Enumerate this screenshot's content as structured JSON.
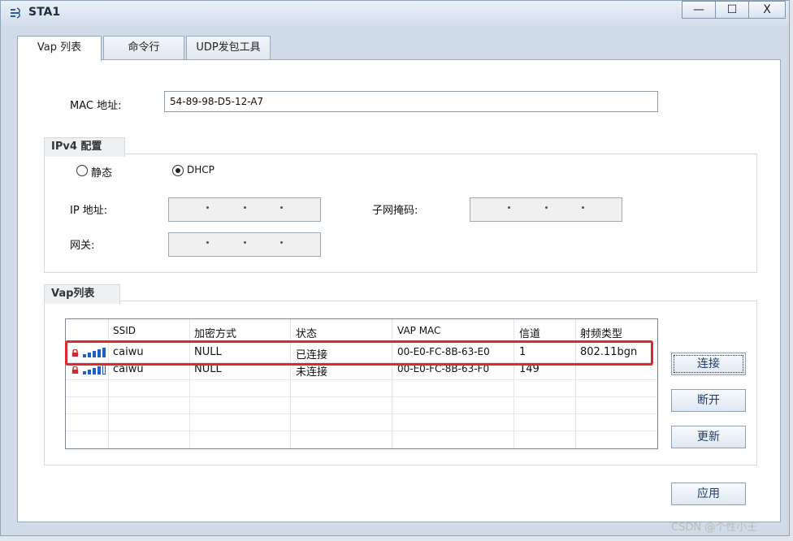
{
  "window": {
    "title": "STA1",
    "min_symbol": "—",
    "max_symbol": "☐",
    "close_symbol": "X"
  },
  "tabs": [
    {
      "label": "Vap 列表"
    },
    {
      "label": "命令行"
    },
    {
      "label": "UDP发包工具"
    }
  ],
  "mac": {
    "label": "MAC 地址:",
    "value": "54-89-98-D5-12-A7"
  },
  "ipv4": {
    "group_label": "IPv4 配置",
    "static_label": "静态",
    "dhcp_label": "DHCP",
    "selected": "DHCP",
    "ip_label": "IP 地址:",
    "mask_label": "子网掩码:",
    "gateway_label": "网关:"
  },
  "vap": {
    "group_label": "Vap列表",
    "columns": [
      "SSID",
      "加密方式",
      "状态",
      "VAP MAC",
      "信道",
      "射频类型"
    ],
    "rows": [
      {
        "ssid": "caiwu",
        "encryption": "NULL",
        "status": "已连接",
        "vap_mac": "00-E0-FC-8B-63-E0",
        "channel": "1",
        "radio_type": "802.11bgn"
      },
      {
        "ssid": "caiwu",
        "encryption": "NULL",
        "status": "未连接",
        "vap_mac": "00-E0-FC-8B-63-F0",
        "channel": "149",
        "radio_type": ""
      }
    ],
    "buttons": {
      "connect": "连接",
      "disconnect": "断开",
      "refresh": "更新"
    }
  },
  "apply_button": "应用",
  "watermark": "CSDN @个性小王",
  "colors": {
    "highlight": "#e3262a",
    "signal": "#1a5fd0",
    "lock": "#d9262d"
  }
}
